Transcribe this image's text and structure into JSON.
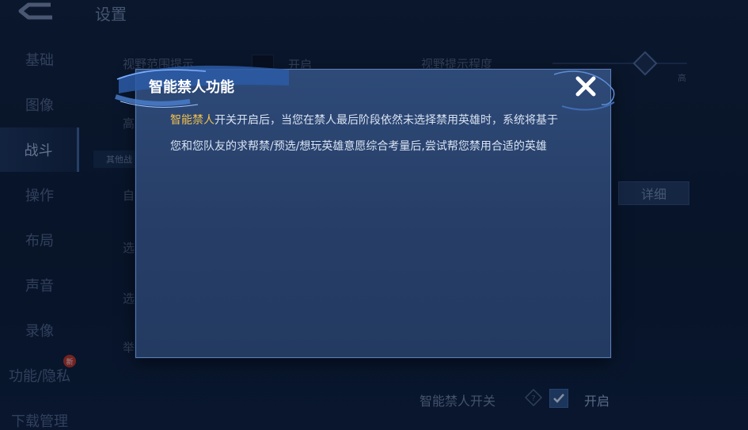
{
  "header": {
    "title": "设置"
  },
  "sidebar": {
    "items": [
      {
        "label": "基础"
      },
      {
        "label": "图像"
      },
      {
        "label": "战斗"
      },
      {
        "label": "操作"
      },
      {
        "label": "布局"
      },
      {
        "label": "声音"
      },
      {
        "label": "录像"
      },
      {
        "label": "功能/隐私",
        "badge": "新"
      },
      {
        "label": "下载管理"
      }
    ],
    "active_index": 2
  },
  "background": {
    "row1_label": "视野范围提示",
    "row1_value": "开启",
    "row2_label": "视野提示程度",
    "slider_high": "高",
    "row3_label": "高",
    "section_tag": "其他战",
    "row_labels": [
      "自",
      "选",
      "选",
      "举"
    ],
    "detail_button": "详细",
    "ban_switch_label": "智能禁人开关",
    "ban_switch_value": "开启",
    "ban_switch_checked": true
  },
  "modal": {
    "title": "智能禁人功能",
    "highlight": "智能禁人",
    "body_line1": "开关开启后，当您在禁人最后阶段依然未选择禁用英雄时，系统将基于",
    "body_line2": "您和您队友的求帮禁/预选/想玩英雄意愿综合考量后,尝试帮您禁用合适的英雄"
  },
  "icons": {
    "back": "back-arrow-icon",
    "close": "close-icon",
    "help": "help-diamond-icon",
    "check": "checkmark-icon"
  },
  "colors": {
    "accent": "#f0c04e",
    "modal_bg": "#2b4572",
    "page_bg": "#0b1a33"
  }
}
